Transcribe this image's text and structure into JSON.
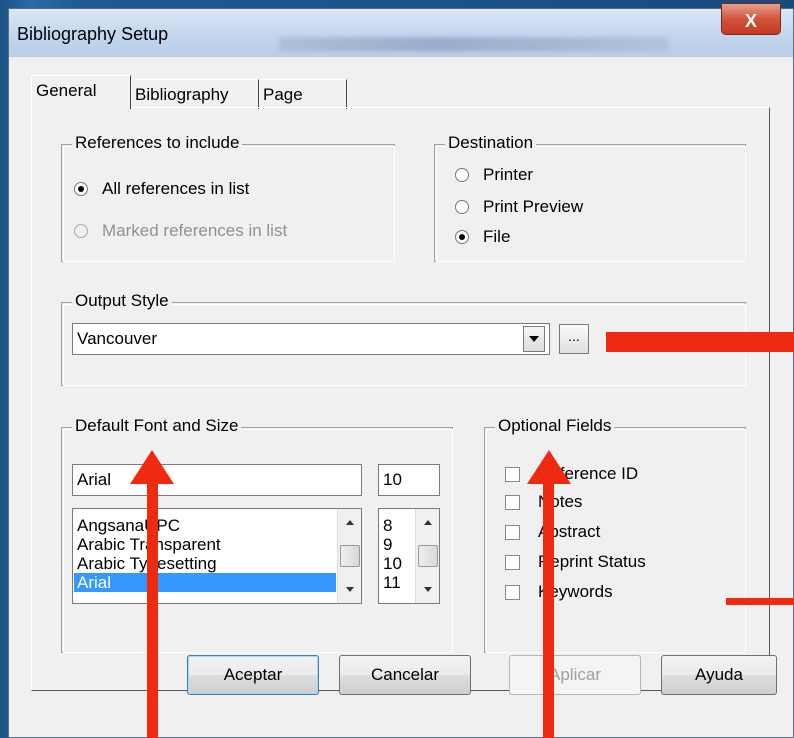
{
  "window": {
    "title": "Bibliography Setup",
    "close_label": "X"
  },
  "tabs": [
    "General",
    "Bibliography",
    "Page"
  ],
  "references": {
    "label": "References to include",
    "options": [
      {
        "label": "All references in list",
        "checked": true,
        "enabled": true
      },
      {
        "label": "Marked references in list",
        "checked": false,
        "enabled": false
      }
    ]
  },
  "destination": {
    "label": "Destination",
    "options": [
      {
        "label": "Printer",
        "checked": false
      },
      {
        "label": "Print Preview",
        "checked": false
      },
      {
        "label": "File",
        "checked": true
      }
    ]
  },
  "output_style": {
    "label": "Output Style",
    "value": "Vancouver",
    "browse_label": "..."
  },
  "font": {
    "label": "Default Font and Size",
    "font_value": "Arial",
    "size_value": "10",
    "font_list": [
      "AngsanaUPC",
      "Arabic Transparent",
      "Arabic Typesetting",
      "Arial"
    ],
    "selected_font": "Arial",
    "size_list": [
      "8",
      "9",
      "10",
      "11"
    ]
  },
  "optional_fields": {
    "label": "Optional Fields",
    "items": [
      "Reference ID",
      "Notes",
      "Abstract",
      "Reprint Status",
      "Keywords"
    ]
  },
  "buttons": {
    "ok": "Aceptar",
    "cancel": "Cancelar",
    "apply": "Aplicar",
    "help": "Ayuda"
  },
  "colors": {
    "annotation": "#f02a10",
    "selection": "#3399ff"
  }
}
